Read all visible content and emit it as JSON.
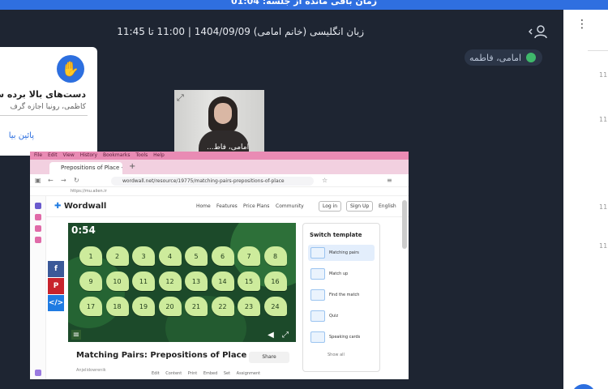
{
  "banner": {
    "text": "زمان باقی مانده از جلسه: 01:04"
  },
  "header": {
    "meeting_info": "زبان انگلیسی (خانم امامی) 1404/09/09 | 11:00 تا 11:45"
  },
  "speaker": {
    "name": "امامی، فاطمه"
  },
  "notification": {
    "title": "دست‌های بالا برده ش",
    "body": "کاظمی، رونیا اجازه گرف",
    "link": "پائین بیا"
  },
  "webcam": {
    "name": "امامی، فاط..."
  },
  "browser": {
    "menu": [
      "File",
      "Edit",
      "View",
      "History",
      "Bookmarks",
      "Tools",
      "Help"
    ],
    "tab_title": "Prepositions of Place - Ma",
    "url": "wordwall.net/resource/19775/matching-pairs-prepositions-of-place",
    "bookmark": "https://mu.alien.ir"
  },
  "wordwall": {
    "logo": "Wordwall",
    "nav": [
      "Home",
      "Features",
      "Price Plans",
      "Community"
    ],
    "login": "Log in",
    "signup": "Sign Up",
    "language": "English"
  },
  "game": {
    "timer": "0:54",
    "tiles": [
      "1",
      "2",
      "3",
      "4",
      "5",
      "6",
      "7",
      "8",
      "9",
      "10",
      "11",
      "12",
      "13",
      "14",
      "15",
      "16",
      "17",
      "18",
      "19",
      "20",
      "21",
      "22",
      "23",
      "24"
    ],
    "title": "Matching Pairs: Prepositions of Place",
    "author": "Anjelidowrenik",
    "share": "Share",
    "actions": "Edit Content   Print   Embed   Set Assignment"
  },
  "templates": {
    "title": "Switch template",
    "items": [
      "Matching pairs",
      "Match up",
      "Find the match",
      "Quiz",
      "Speaking cards"
    ],
    "show_all": "Show all"
  },
  "chat": {
    "numbers": [
      "11",
      "11",
      "11",
      "11"
    ]
  },
  "colors": {
    "banner": "#2f6fe0",
    "dark_bg": "#1e2532",
    "accent": "#2d6fdf",
    "tile": "#cdeb9c"
  }
}
